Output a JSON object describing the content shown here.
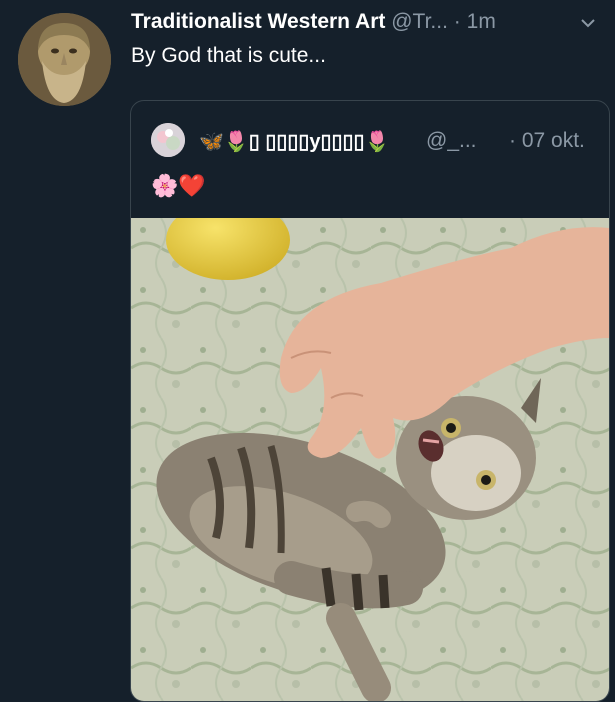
{
  "tweet": {
    "author_name": "Traditionalist Western Art",
    "author_handle": "@Tr...",
    "separator": "·",
    "time": "1m",
    "text": "By God that is cute...",
    "avatar_icon": "bust-portrait-avatar",
    "caret_icon": "chevron-down-icon"
  },
  "quoted": {
    "display_name": "🦋🌷▯ ▯▯▯▯y▯▯▯▯🌷",
    "handle": "@_...",
    "separator": "·",
    "date": "07 okt.",
    "bio_emojis": "🌸❤️",
    "avatar_icon": "floral-avatar",
    "media_icon": "kitten-photo"
  },
  "colors": {
    "background": "#15202b",
    "border": "#38444d",
    "secondary_text": "#8b98a5",
    "primary_text": "#ffffff"
  }
}
